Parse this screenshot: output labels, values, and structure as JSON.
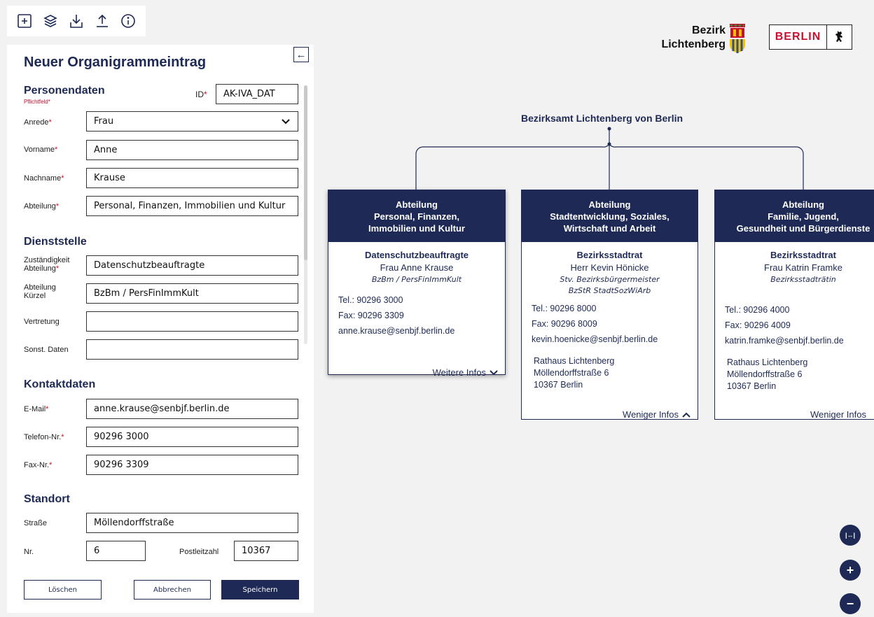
{
  "toolbar": {
    "icons": [
      "add-node-icon",
      "layers-icon",
      "download-icon",
      "upload-icon",
      "info-icon"
    ]
  },
  "panel": {
    "title": "Neuer Organigrammeintrag",
    "collapse_glyph": "←",
    "personal": {
      "title": "Personendaten",
      "required_note": "Pflichtfeld",
      "id_label": "ID",
      "id_value": "AK-IVA_DAT",
      "salutation_label": "Anrede",
      "salutation_value": "Frau",
      "firstname_label": "Vorname",
      "firstname_value": "Anne",
      "lastname_label": "Nachname",
      "lastname_value": "Krause",
      "department_label": "Abteilung",
      "department_value": "Personal, Finanzen, Immobilien und Kultur"
    },
    "office": {
      "title": "Dienststelle",
      "resp_label_1": "Zuständigkeit",
      "resp_label_2": "Abteilung",
      "resp_value": "Datenschutzbeauftragte",
      "abbr_label_1": "Abteilung",
      "abbr_label_2": "Kürzel",
      "abbr_value": "BzBm / PersFinImmKult",
      "deputy_label": "Vertretung",
      "deputy_value": "",
      "other_label": "Sonst. Daten",
      "other_value": ""
    },
    "contact": {
      "title": "Kontaktdaten",
      "email_label": "E-Mail",
      "email_value": "anne.krause@senbjf.berlin.de",
      "phone_label": "Telefon-Nr.",
      "phone_value": "90296 3000",
      "fax_label": "Fax-Nr.",
      "fax_value": "90296 3309"
    },
    "location": {
      "title": "Standort",
      "street_label": "Straße",
      "street_value": "Möllendorffstraße",
      "nr_label": "Nr.",
      "nr_value": "6",
      "zip_label": "Postleitzahl",
      "zip_value": "10367"
    },
    "buttons": {
      "delete": "Löschen",
      "cancel": "Abbrechen",
      "save": "Speichern"
    }
  },
  "logos": {
    "bezirk_line1": "Bezirk",
    "bezirk_line2": "Lichtenberg",
    "berlin": "BERLIN"
  },
  "org": {
    "root_title": "Bezirksamt Lichtenberg von Berlin",
    "cards": [
      {
        "head": [
          "Abteilung",
          "Personal, Finanzen,",
          "Immobilien und Kultur"
        ],
        "role": "Datenschutzbeauftragte",
        "name": "Frau Anne Krause",
        "sub1": "BzBm / PersFinImmKult",
        "sub2": "",
        "tel": "Tel.: 90296 3000",
        "fax": "Fax: 90296 3309",
        "email": "anne.krause@senbjf.berlin.de",
        "addr": [],
        "more": "Weitere Infos"
      },
      {
        "head": [
          "Abteilung",
          "Stadtentwicklung, Soziales,",
          "Wirtschaft und Arbeit"
        ],
        "role": "Bezirksstadtrat",
        "name": "Herr Kevin Hönicke",
        "sub1": "Stv. Bezirksbürgermeister",
        "sub2": "BzStR StadtSozWiArb",
        "tel": "Tel.: 90296 8000",
        "fax": "Fax: 90296 8009",
        "email": "kevin.hoenicke@senbjf.berlin.de",
        "addr": [
          "Rathaus Lichtenberg",
          "Möllendorffstraße 6",
          "10367 Berlin"
        ],
        "more": "Weniger Infos"
      },
      {
        "head": [
          "Abteilung",
          "Familie, Jugend,",
          "Gesundheit und Bürgerdienste"
        ],
        "role": "Bezirksstadtrat",
        "name": "Frau Katrin Framke",
        "sub1": "Bezirksstadträtin",
        "sub2": "",
        "tel": "Tel.: 90296 4000",
        "fax": "Fax: 90296 4009",
        "email": "katrin.framke@senbjf.berlin.de",
        "addr": [
          "Rathaus Lichtenberg",
          "Möllendorffstraße 6",
          "10367 Berlin"
        ],
        "more": "Weniger Infos"
      }
    ]
  },
  "zoom": {
    "icons": [
      "fit-width-icon",
      "zoom-in-icon",
      "zoom-out-icon"
    ],
    "fit_glyph": "|↔|",
    "in_glyph": "+",
    "out_glyph": "−"
  }
}
